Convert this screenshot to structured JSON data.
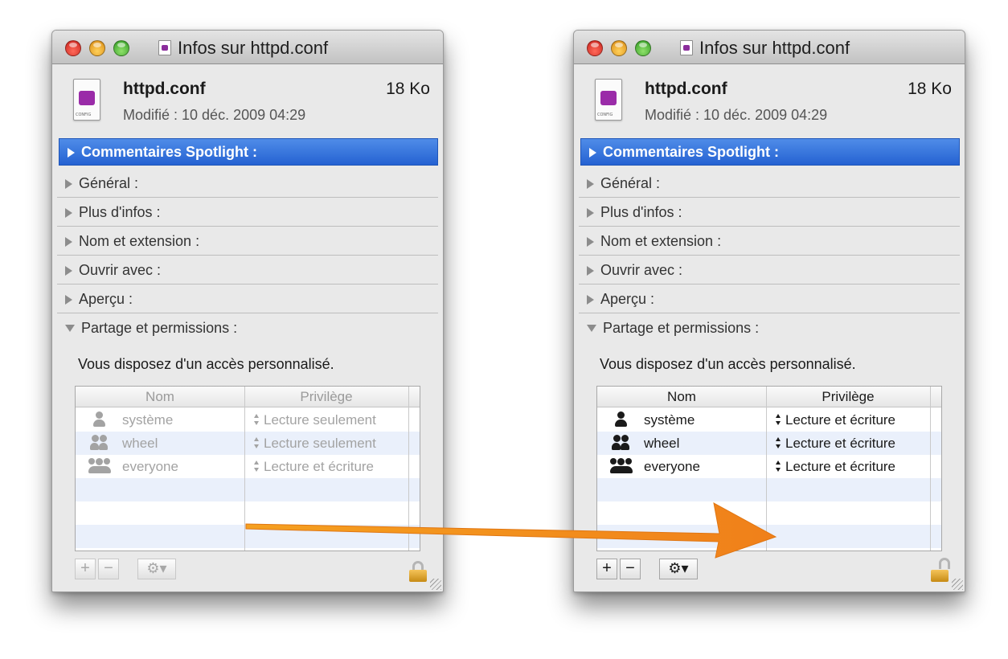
{
  "window_title": "Infos sur httpd.conf",
  "file": {
    "name": "httpd.conf",
    "size": "18 Ko",
    "modified": "Modifié :  10 déc. 2009 04:29"
  },
  "sections": {
    "spotlight": "Commentaires Spotlight :",
    "general": "Général :",
    "more_info": "Plus d'infos :",
    "name_ext": "Nom et extension :",
    "open_with": "Ouvrir avec :",
    "preview": "Aperçu :",
    "sharing": "Partage et permissions :"
  },
  "access_text": "Vous disposez d'un accès personnalisé.",
  "table_headers": {
    "name": "Nom",
    "privilege": "Privilège"
  },
  "before": {
    "rows": [
      {
        "name": "système",
        "privilege": "Lecture seulement"
      },
      {
        "name": "wheel",
        "privilege": "Lecture seulement"
      },
      {
        "name": "everyone",
        "privilege": "Lecture et écriture"
      }
    ]
  },
  "after": {
    "rows": [
      {
        "name": "système",
        "privilege": "Lecture et écriture"
      },
      {
        "name": "wheel",
        "privilege": "Lecture et écriture"
      },
      {
        "name": "everyone",
        "privilege": "Lecture et écriture"
      }
    ]
  },
  "buttons": {
    "plus": "+",
    "minus": "−",
    "gear": "⚙▾"
  },
  "colors": {
    "selection": "#2f6ed8",
    "arrow": "#f08a1a",
    "accent_lock": "#e4a52a"
  }
}
